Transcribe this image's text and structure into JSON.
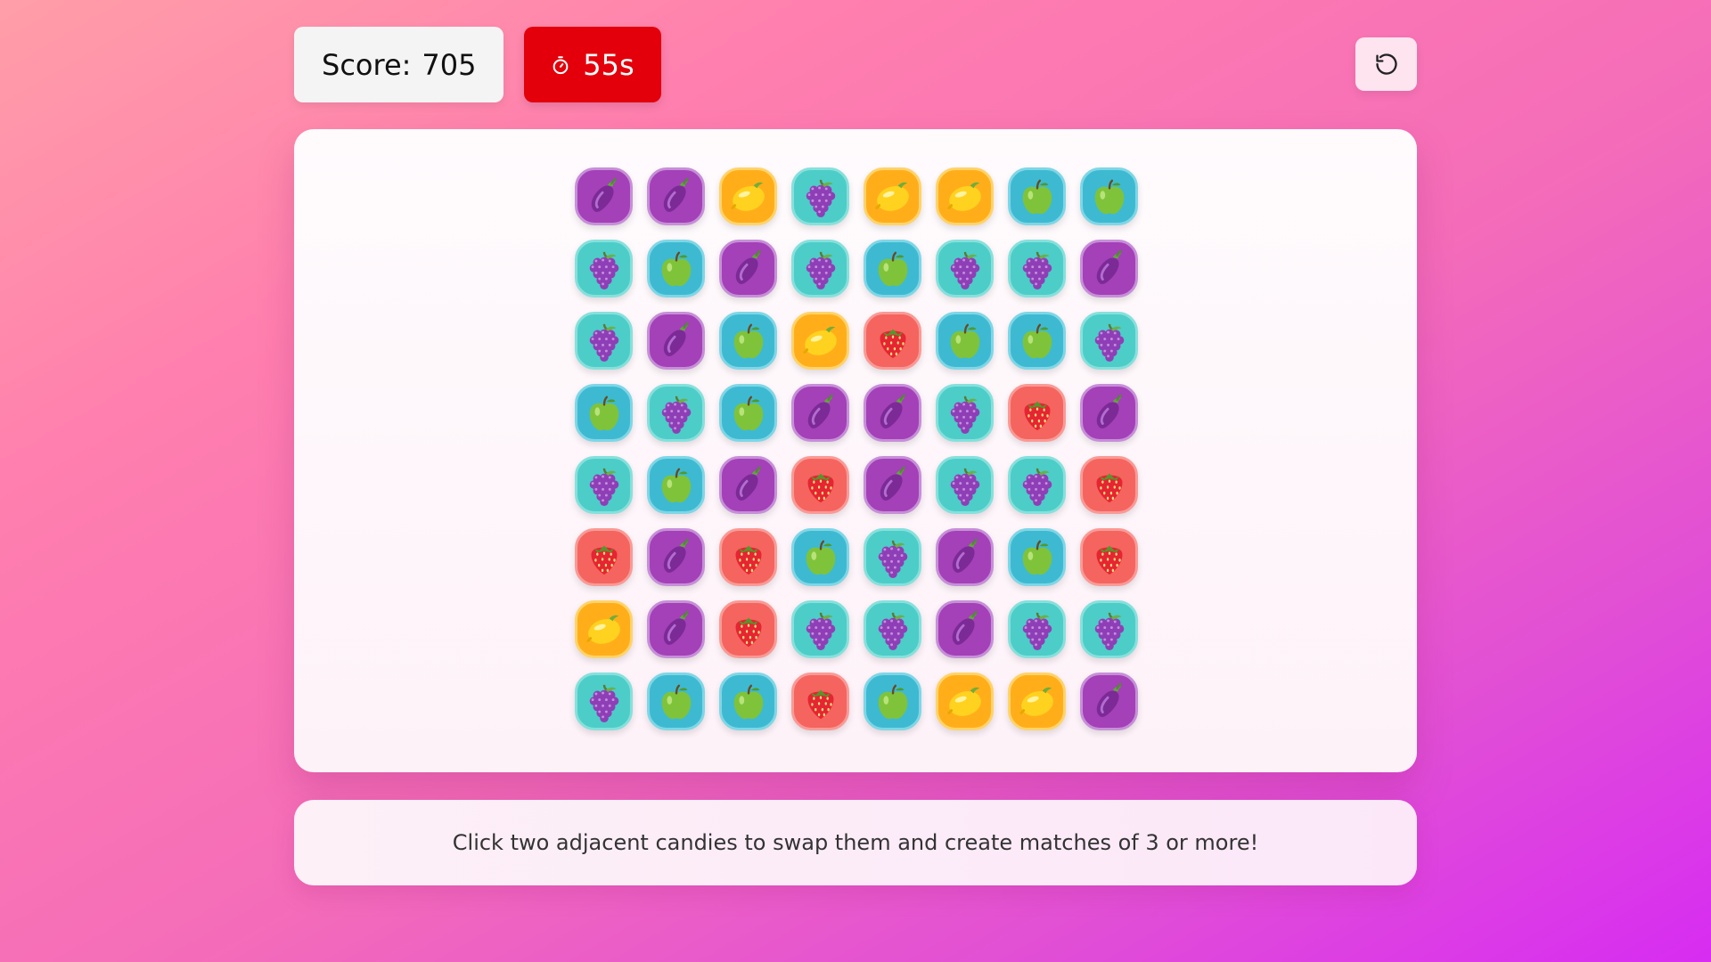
{
  "header": {
    "score_label": "Score:",
    "score_value": "705",
    "timer_value": "55s",
    "timer_icon": "stopwatch-icon",
    "reset_icon": "reset-icon"
  },
  "board": {
    "rows": [
      [
        "eggplant",
        "eggplant",
        "lemon",
        "grapes",
        "lemon",
        "lemon",
        "apple",
        "apple"
      ],
      [
        "grapes",
        "apple",
        "eggplant",
        "grapes",
        "apple",
        "grapes",
        "grapes",
        "eggplant"
      ],
      [
        "grapes",
        "eggplant",
        "apple",
        "lemon",
        "strawberry",
        "apple",
        "apple",
        "grapes"
      ],
      [
        "apple",
        "grapes",
        "apple",
        "eggplant",
        "eggplant",
        "grapes",
        "strawberry",
        "eggplant"
      ],
      [
        "grapes",
        "apple",
        "eggplant",
        "strawberry",
        "eggplant",
        "grapes",
        "grapes",
        "strawberry"
      ],
      [
        "strawberry",
        "eggplant",
        "strawberry",
        "apple",
        "grapes",
        "eggplant",
        "apple",
        "strawberry"
      ],
      [
        "lemon",
        "eggplant",
        "strawberry",
        "grapes",
        "grapes",
        "eggplant",
        "grapes",
        "grapes"
      ],
      [
        "grapes",
        "apple",
        "apple",
        "strawberry",
        "apple",
        "lemon",
        "lemon",
        "eggplant"
      ]
    ]
  },
  "instructions": {
    "text": "Click two adjacent candies to swap them and create matches of 3 or more!"
  },
  "colors": {
    "timer_bg": "#e3000b",
    "eggplant": "#a440b8",
    "grapes": "#4ccdc8",
    "lemon": "#ffae1a",
    "apple": "#3dbad2",
    "strawberry": "#f5645f"
  }
}
